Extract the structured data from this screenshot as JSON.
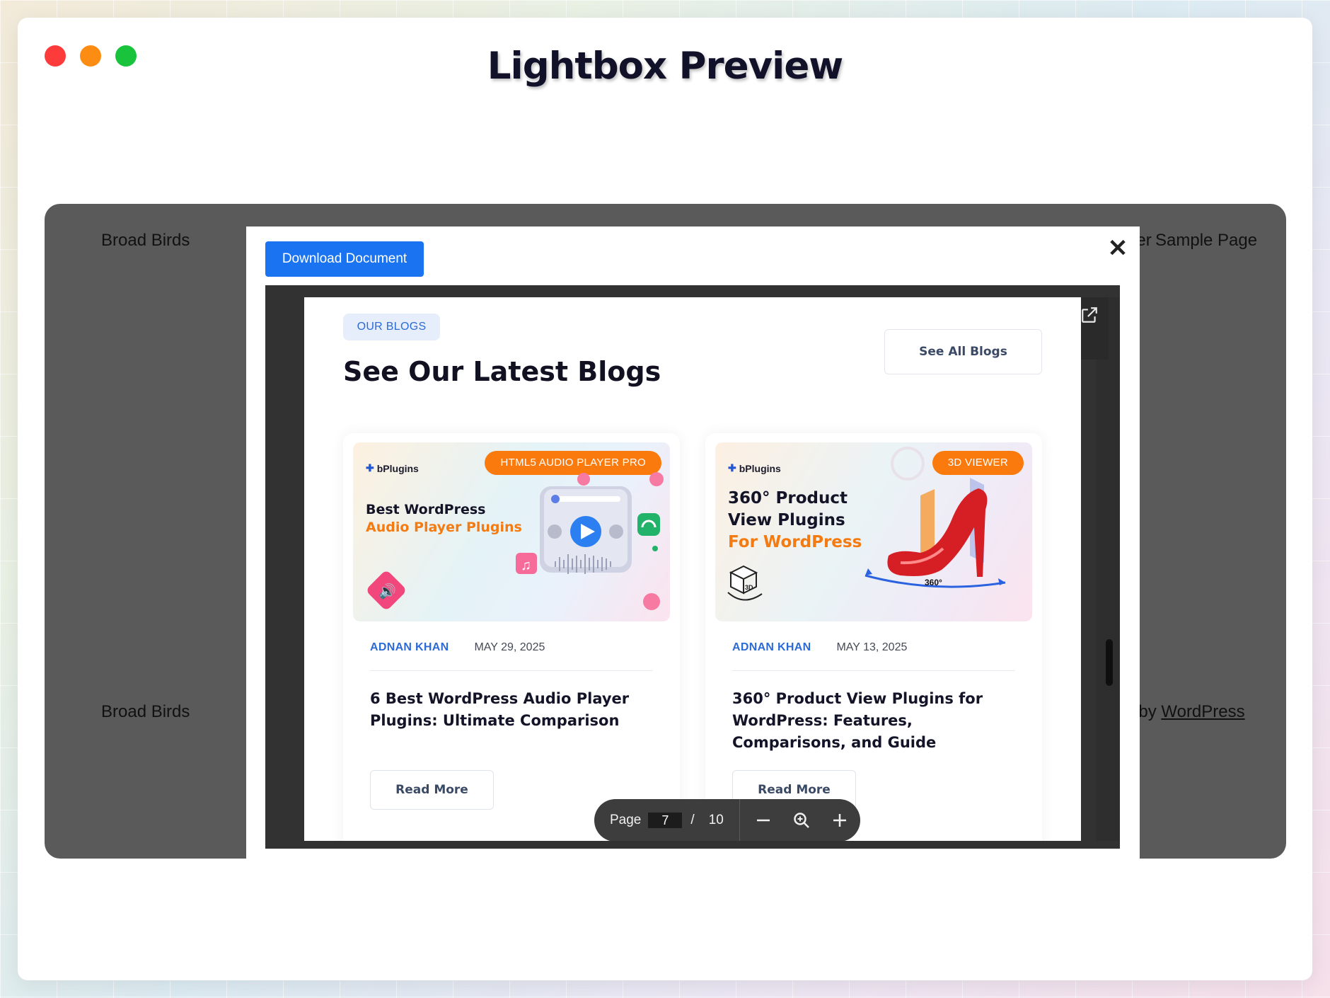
{
  "window": {
    "title": "Lightbox Preview",
    "traffic_lights": [
      "close",
      "minimize",
      "maximize"
    ]
  },
  "background_site": {
    "site_title_top": "Broad Birds",
    "nav_partial": "der",
    "nav_sample_page": "Sample Page",
    "site_title_bottom": "Broad Birds",
    "footer_partial": "red by ",
    "footer_link": "WordPress"
  },
  "lightbox": {
    "download_label": "Download Document",
    "close_icon": "close-icon",
    "open_external_icon": "external-link-icon"
  },
  "document": {
    "tag": "OUR BLOGS",
    "heading": "See Our Latest Blogs",
    "see_all_label": "See All Blogs",
    "cards": [
      {
        "brand": "bPlugins",
        "badge": "HTML5 AUDIO PLAYER PRO",
        "thumb_line1": "Best WordPress",
        "thumb_line2": "Audio Player Plugins",
        "author": "ADNAN KHAN",
        "date": "MAY 29, 2025",
        "title": "6 Best WordPress Audio Player Plugins: Ultimate Comparison",
        "read_more": "Read More"
      },
      {
        "brand": "bPlugins",
        "badge": "3D VIEWER",
        "thumb_line1": "360° Product",
        "thumb_line2": "View Plugins",
        "thumb_line3": "For WordPress",
        "thumb_caption": "360°",
        "author": "ADNAN KHAN",
        "date": "MAY 13, 2025",
        "title": "360° Product View Plugins for WordPress: Features, Comparisons, and Guide",
        "read_more": "Read More"
      }
    ]
  },
  "toolbar": {
    "page_label": "Page",
    "current_page": "7",
    "separator": "/",
    "total_pages": "10",
    "zoom_out_icon": "minus-icon",
    "zoom_icon": "zoom-icon",
    "zoom_in_icon": "plus-icon"
  },
  "colors": {
    "accent_blue": "#1a73f0",
    "badge_orange": "#fb7a0d",
    "author_blue": "#2c6ad6"
  }
}
